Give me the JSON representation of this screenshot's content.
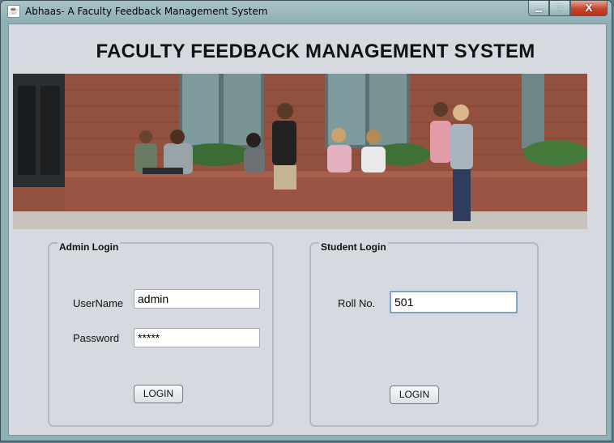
{
  "window": {
    "title": "Abhaas- A Faculty Feedback Management System",
    "controls": {
      "minimize": "▁",
      "maximize": "□",
      "close": "X"
    }
  },
  "header": {
    "title": "FACULTY FEEDBACK MANAGEMENT SYSTEM"
  },
  "admin_login": {
    "title": "Admin Login",
    "username_label": "UserName",
    "username_value": "admin",
    "password_label": "Password",
    "password_value": "*****",
    "login_button": "LOGIN"
  },
  "student_login": {
    "title": "Student Login",
    "roll_label": "Roll No.",
    "roll_value": "501",
    "login_button": "LOGIN"
  },
  "colors": {
    "client_bg": "#d6d9df",
    "brick": "#8a4e3e",
    "window_frame": "#8fb0b5"
  }
}
